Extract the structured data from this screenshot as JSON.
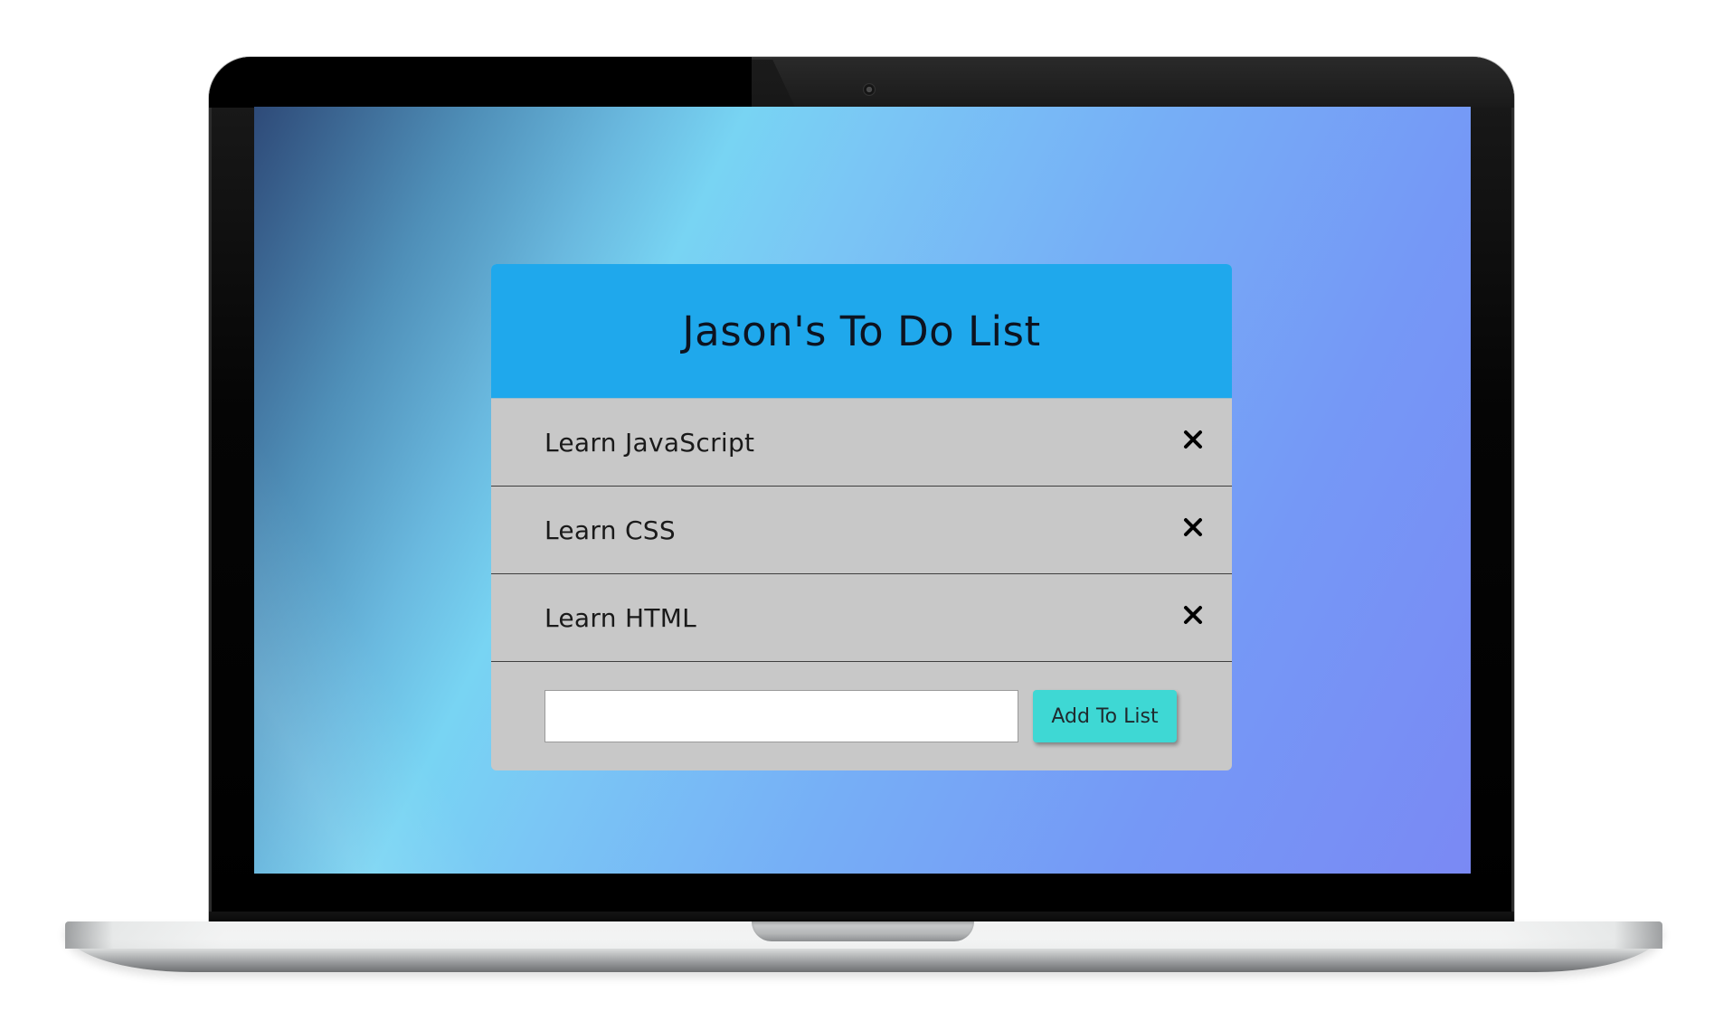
{
  "app": {
    "title": "Jason's To Do List"
  },
  "todos": [
    {
      "text": "Learn JavaScript",
      "delete_icon": "close-icon"
    },
    {
      "text": "Learn CSS",
      "delete_icon": "close-icon"
    },
    {
      "text": "Learn HTML",
      "delete_icon": "close-icon"
    }
  ],
  "form": {
    "input_value": "",
    "input_placeholder": "",
    "add_button_label": "Add To List"
  },
  "colors": {
    "header_bg": "#1fa8ec",
    "card_bg": "#c8c8c8",
    "button_bg": "#3ed8d4"
  }
}
